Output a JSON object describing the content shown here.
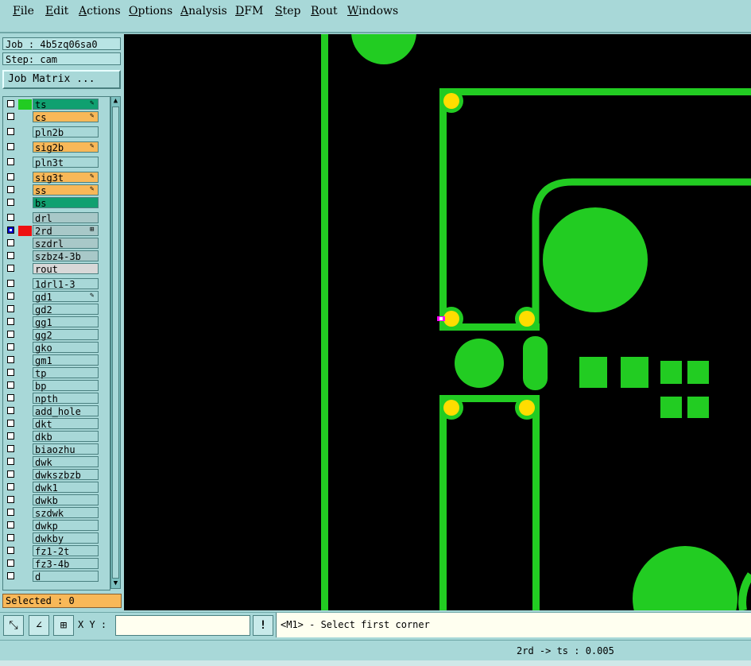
{
  "menu": [
    "File",
    "Edit",
    "Actions",
    "Options",
    "Analysis",
    "DFM",
    "Step",
    "Rout",
    "Windows"
  ],
  "job_label": "Job : 4b5zq06sa0",
  "step_label": "Step: cam",
  "job_matrix_label": "Job Matrix ...",
  "layers": [
    {
      "name": "ts",
      "bg": "#10a070",
      "swatch": "#22cc22",
      "mark": "✎"
    },
    {
      "name": "cs",
      "bg": "#f8b858",
      "swatch": "",
      "mark": "✎"
    },
    {
      "name": "pln2b",
      "bg": "#a8d8d8",
      "swatch": "",
      "mark": ""
    },
    {
      "name": "sig2b",
      "bg": "#f8b858",
      "swatch": "",
      "mark": "✎"
    },
    {
      "name": "pln3t",
      "bg": "#a8d8d8",
      "swatch": "",
      "mark": ""
    },
    {
      "name": "sig3t",
      "bg": "#f8b858",
      "swatch": "",
      "mark": "✎"
    },
    {
      "name": "ss",
      "bg": "#f8b858",
      "swatch": "",
      "mark": "✎"
    },
    {
      "name": "bs",
      "bg": "#10a070",
      "swatch": "",
      "mark": ""
    },
    {
      "name": "drl",
      "bg": "#a8c8c8",
      "swatch": "",
      "mark": ""
    },
    {
      "name": "2rd",
      "bg": "#a8c8c8",
      "swatch": "#ee1111",
      "mark": "⊞",
      "selected": true
    },
    {
      "name": "szdrl",
      "bg": "#a8c8c8",
      "swatch": "",
      "mark": ""
    },
    {
      "name": "szbz4-3b",
      "bg": "#a8c8c8",
      "swatch": "",
      "mark": ""
    },
    {
      "name": "rout",
      "bg": "#d8d8d8",
      "swatch": "",
      "mark": ""
    },
    {
      "name": "1drl1-3",
      "bg": "#a8d8d8",
      "swatch": "",
      "mark": ""
    },
    {
      "name": "gd1",
      "bg": "#a8d8d8",
      "swatch": "",
      "mark": "✎"
    },
    {
      "name": "gd2",
      "bg": "#a8d8d8",
      "swatch": "",
      "mark": ""
    },
    {
      "name": "gg1",
      "bg": "#a8d8d8",
      "swatch": "",
      "mark": ""
    },
    {
      "name": "gg2",
      "bg": "#a8d8d8",
      "swatch": "",
      "mark": ""
    },
    {
      "name": "gko",
      "bg": "#a8d8d8",
      "swatch": "",
      "mark": ""
    },
    {
      "name": "gm1",
      "bg": "#a8d8d8",
      "swatch": "",
      "mark": ""
    },
    {
      "name": "tp",
      "bg": "#a8d8d8",
      "swatch": "",
      "mark": ""
    },
    {
      "name": "bp",
      "bg": "#a8d8d8",
      "swatch": "",
      "mark": ""
    },
    {
      "name": "npth",
      "bg": "#a8d8d8",
      "swatch": "",
      "mark": ""
    },
    {
      "name": "add_hole",
      "bg": "#a8d8d8",
      "swatch": "",
      "mark": ""
    },
    {
      "name": "dkt",
      "bg": "#a8d8d8",
      "swatch": "",
      "mark": ""
    },
    {
      "name": "dkb",
      "bg": "#a8d8d8",
      "swatch": "",
      "mark": ""
    },
    {
      "name": "biaozhu",
      "bg": "#a8d8d8",
      "swatch": "",
      "mark": ""
    },
    {
      "name": "dwk",
      "bg": "#a8d8d8",
      "swatch": "",
      "mark": ""
    },
    {
      "name": "dwkszbzb",
      "bg": "#a8d8d8",
      "swatch": "",
      "mark": ""
    },
    {
      "name": "dwk1",
      "bg": "#a8d8d8",
      "swatch": "",
      "mark": ""
    },
    {
      "name": "dwkb",
      "bg": "#a8d8d8",
      "swatch": "",
      "mark": ""
    },
    {
      "name": "szdwk",
      "bg": "#a8d8d8",
      "swatch": "",
      "mark": ""
    },
    {
      "name": "dwkp",
      "bg": "#a8d8d8",
      "swatch": "",
      "mark": ""
    },
    {
      "name": "dwkby",
      "bg": "#a8d8d8",
      "swatch": "",
      "mark": ""
    },
    {
      "name": "fz1-2t",
      "bg": "#a8d8d8",
      "swatch": "",
      "mark": ""
    },
    {
      "name": "fz3-4b",
      "bg": "#a8d8d8",
      "swatch": "",
      "mark": ""
    },
    {
      "name": "d",
      "bg": "#a8d8d8",
      "swatch": "",
      "mark": ""
    }
  ],
  "selected_label": "Selected : 0",
  "xy_label": "X Y :",
  "xy_value": "",
  "warn_symbol": "!",
  "prompt": "<M1> - Select first corner",
  "status": "2rd -> ts : 0.005",
  "colors": {
    "copper": "#22cc22",
    "pad": "#ffdd00",
    "marker": "#ff00ff",
    "canvas": "#000000",
    "panel": "#a8d8d8"
  }
}
